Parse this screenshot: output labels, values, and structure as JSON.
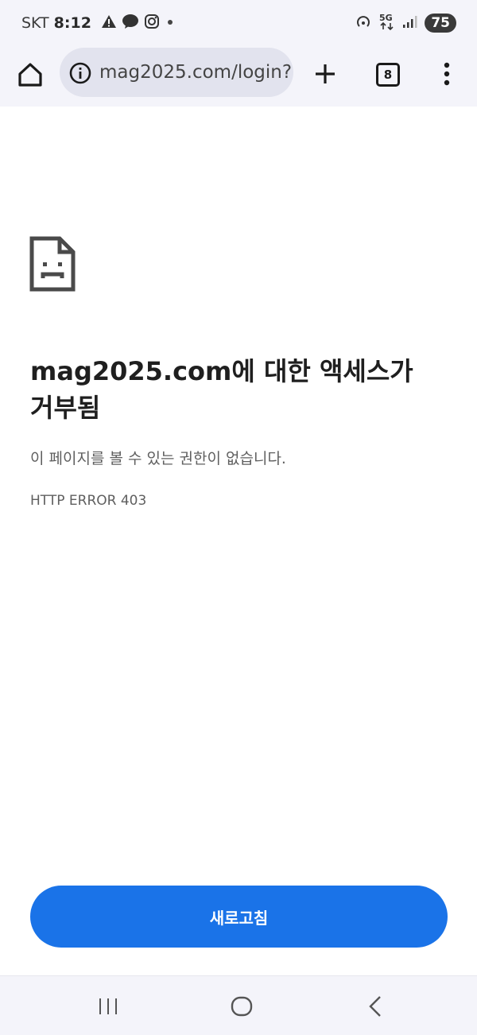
{
  "status_bar": {
    "carrier": "SKT",
    "time": "8:12",
    "network": "5G",
    "battery": "75",
    "icons": [
      "warning-icon",
      "kakaotalk-icon",
      "instagram-icon",
      "dot-icon",
      "hotspot-icon",
      "5g-data-icon",
      "signal-icon",
      "battery-icon"
    ]
  },
  "browser": {
    "url": "mag2025.com/login?",
    "tab_count": "8",
    "icons": [
      "home-icon",
      "info-icon",
      "plus-icon",
      "tabs-icon",
      "more-vert-icon"
    ]
  },
  "error_page": {
    "title": "mag2025.com에 대한 액세스가 거부됨",
    "description": "이 페이지를 볼 수 있는 권한이 없습니다.",
    "code": "HTTP ERROR 403",
    "reload_label": "새로고침",
    "icon": "sad-page-icon"
  },
  "nav_bar": {
    "icons": [
      "recents-icon",
      "home-circle-icon",
      "back-icon"
    ]
  },
  "colors": {
    "accent": "#1a73e8",
    "chrome_bg": "#f4f4fa",
    "omnibox_bg": "#e2e3ee"
  }
}
